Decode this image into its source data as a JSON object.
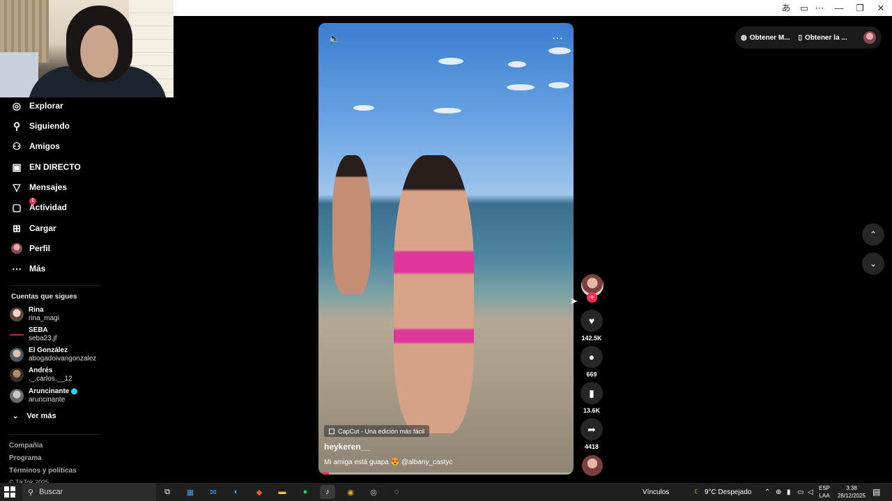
{
  "browser": {
    "icons": [
      "translate-icon",
      "cast-icon",
      "more-icon",
      "minimize-icon",
      "restore-icon",
      "close-icon"
    ]
  },
  "sidebar": {
    "nav": [
      {
        "label": "Explorar",
        "icon": "compass-icon"
      },
      {
        "label": "Siguiendo",
        "icon": "following-icon"
      },
      {
        "label": "Amigos",
        "icon": "friends-icon"
      },
      {
        "label": "EN DIRECTO",
        "icon": "live-icon"
      },
      {
        "label": "Mensajes",
        "icon": "messages-icon"
      },
      {
        "label": "Actividad",
        "icon": "activity-icon",
        "badge": "1"
      },
      {
        "label": "Cargar",
        "icon": "upload-icon"
      },
      {
        "label": "Perfil",
        "icon": "avatar"
      },
      {
        "label": "Más",
        "icon": "more-icon"
      }
    ],
    "following_title": "Cuentas que sigues",
    "following": [
      {
        "name": "Rina",
        "handle": "rina_magi"
      },
      {
        "name": "SEBA",
        "handle": "seba23.jf"
      },
      {
        "name": "El González",
        "handle": "abogadoivangonzalez"
      },
      {
        "name": "Andrés",
        "handle": "._.carlos.__12"
      },
      {
        "name": "Aruncinante",
        "handle": "aruncinante",
        "verified": true
      }
    ],
    "see_more": "Ver más",
    "footer": [
      "Compañía",
      "Programa",
      "Términos y políticas",
      "© TikTok 2025"
    ]
  },
  "video": {
    "effect": "CapCut - Una edición más fácil",
    "author": "heykeren__",
    "caption": "Mi amiga está guapa 😍 @albany_castyc",
    "progress": 0.04
  },
  "actions": {
    "likes": "142.5K",
    "comments": "669",
    "saves": "13.6K",
    "shares": "4418"
  },
  "top_actions": {
    "get_coins": "Obtener M...",
    "get_app": "Obtener la ..."
  },
  "taskbar": {
    "search_placeholder": "Buscar",
    "links": "Vínculos",
    "weather": "9°C  Despejado",
    "lang1": "ESP",
    "lang2": "LAA",
    "time": "3:38",
    "date": "28/12/2025"
  },
  "colors": {
    "accent": "#fe2c55",
    "background": "#000000",
    "taskbar": "#1f1f1f"
  }
}
